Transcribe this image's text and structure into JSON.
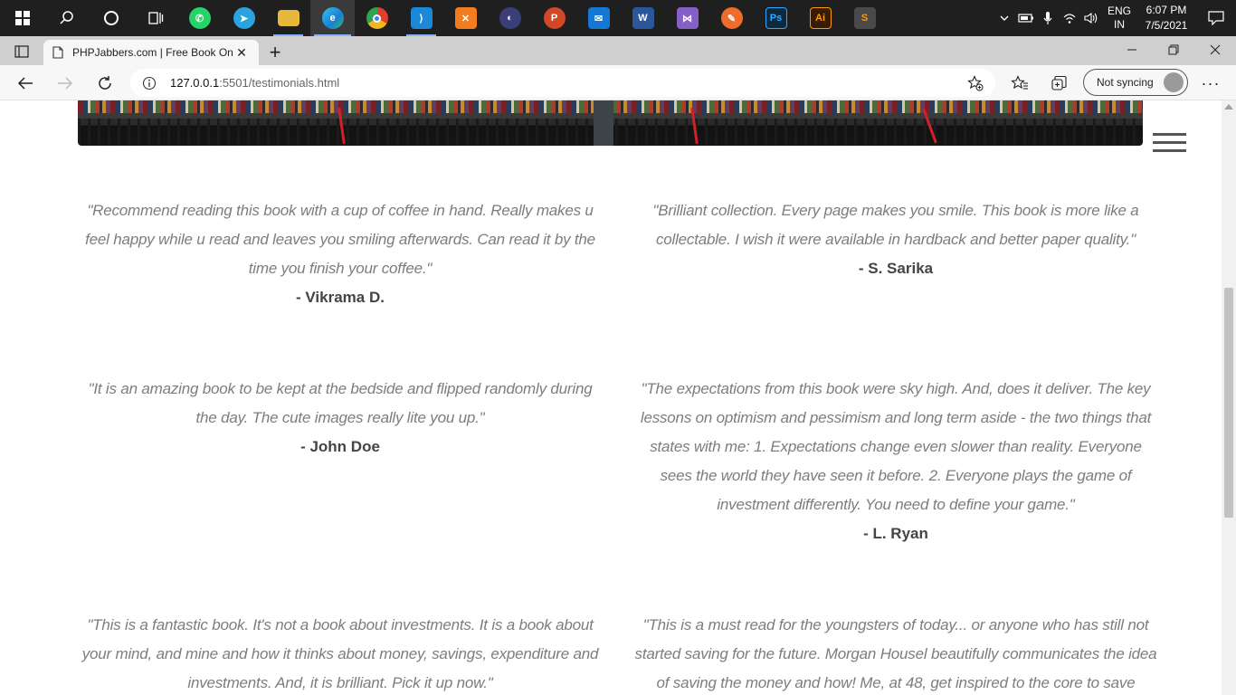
{
  "taskbar": {
    "apps": [
      {
        "name": "search-icon",
        "glyph": "⌕"
      },
      {
        "name": "cortana-icon",
        "glyph": "○"
      },
      {
        "name": "task-view-icon",
        "glyph": "▤"
      },
      {
        "name": "whatsapp-icon",
        "glyph": "✆",
        "color": "#25d366"
      },
      {
        "name": "telegram-icon",
        "glyph": "➤",
        "color": "#2aa3df"
      },
      {
        "name": "file-explorer-icon",
        "glyph": "▬",
        "color": "#e8b83b"
      },
      {
        "name": "edge-icon",
        "glyph": "e",
        "color": "#1a8ad6"
      },
      {
        "name": "chrome-icon",
        "glyph": "◉",
        "color": "#e0402b"
      },
      {
        "name": "vscode-icon",
        "glyph": "⟩",
        "color": "#1e88d8"
      },
      {
        "name": "xampp-icon",
        "glyph": "✕",
        "color": "#f47c20"
      },
      {
        "name": "eclipse-icon",
        "glyph": "◐",
        "color": "#3a3f7a"
      },
      {
        "name": "powerpoint-icon",
        "glyph": "P",
        "color": "#d24726"
      },
      {
        "name": "mail-icon",
        "glyph": "✉",
        "color": "#1777d4"
      },
      {
        "name": "word-icon",
        "glyph": "W",
        "color": "#2b579a"
      },
      {
        "name": "visual-studio-icon",
        "glyph": "⋈",
        "color": "#8661c5"
      },
      {
        "name": "postman-icon",
        "glyph": "✎",
        "color": "#ef6c2b"
      },
      {
        "name": "photoshop-icon",
        "glyph": "Ps",
        "color": "#0b2a3e"
      },
      {
        "name": "illustrator-icon",
        "glyph": "Ai",
        "color": "#3a1d00"
      },
      {
        "name": "sublime-icon",
        "glyph": "S",
        "color": "#4a4a4a"
      }
    ],
    "lang_top": "ENG",
    "lang_bottom": "IN",
    "time": "6:07 PM",
    "date": "7/5/2021"
  },
  "browser": {
    "tab_title": "PHPJabbers.com | Free Book Online",
    "tab_close": "✕",
    "new_tab": "+",
    "url_host": "127.0.0.1",
    "url_rest": ":5501/testimonials.html",
    "sync_label": "Not syncing",
    "more": "···"
  },
  "testimonials": [
    {
      "quote": "\"Recommend reading this book with a cup of coffee in hand. Really makes u feel happy while u read and leaves you smiling afterwards. Can read it by the time you finish your coffee.\"",
      "author": "- Vikrama D."
    },
    {
      "quote": "\"Brilliant collection. Every page makes you smile. This book is more like a collectable. I wish it were available in hardback and better paper quality.\"",
      "author": "- S. Sarika"
    },
    {
      "quote": "\"It is an amazing book to be kept at the bedside and flipped randomly during the day. The cute images really lite you up.\"",
      "author": "- John Doe"
    },
    {
      "quote": "\"The expectations from this book were sky high. And, does it deliver. The key lessons on optimism and pessimism and long term aside - the two things that states with me: 1. Expectations change even slower than reality. Everyone sees the world they have seen it before. 2. Everyone plays the game of investment differently. You need to define your game.\"",
      "author": "- L. Ryan"
    },
    {
      "quote": "\"This is a fantastic book. It's not a book about investments. It is a book about your mind, and mine and how it thinks about money, savings, expenditure and investments. And, it is brilliant. Pick it up now.\"",
      "author": ""
    },
    {
      "quote": "\"This is a must read for the youngsters of today... or anyone who has still not started saving for the future. Morgan Housel beautifully communicates the idea of saving the money and how! Me, at 48, get inspired to the core to save",
      "author": ""
    }
  ]
}
